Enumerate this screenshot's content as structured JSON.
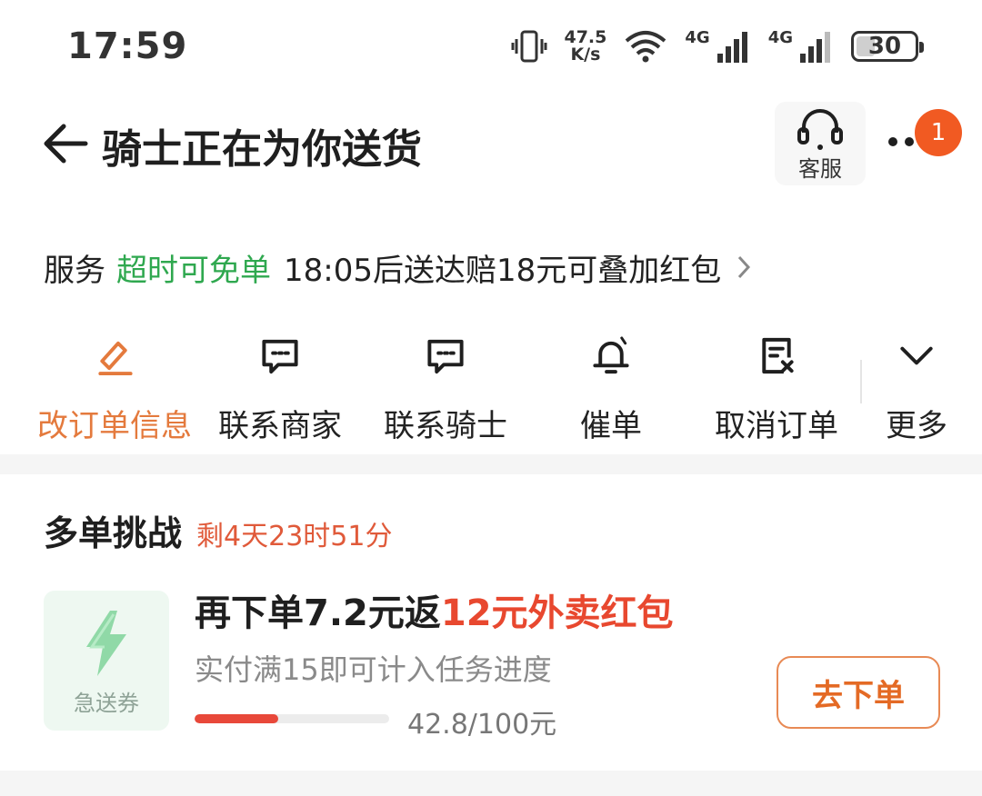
{
  "status_bar": {
    "time": "17:59",
    "speed_value": "47.5",
    "speed_unit": "K/s",
    "net1": "4G",
    "net2": "4G",
    "battery": "30"
  },
  "header": {
    "title": "骑士正在为你送货",
    "support_label": "客服",
    "badge_count": "1"
  },
  "service": {
    "label": "服务",
    "tag": "超时可免单",
    "description": "18:05后送达赔18元可叠加红包"
  },
  "actions": [
    {
      "label": "改订单信息",
      "icon": "edit-icon",
      "active": true
    },
    {
      "label": "联系商家",
      "icon": "chat-icon"
    },
    {
      "label": "联系骑士",
      "icon": "chat-icon"
    },
    {
      "label": "催单",
      "icon": "bell-icon"
    },
    {
      "label": "取消订单",
      "icon": "cancel-doc-icon"
    },
    {
      "label": "更多",
      "icon": "chevron-down-icon"
    }
  ],
  "challenge": {
    "title": "多单挑战",
    "timer": "剩4天23时51分",
    "coupon_label": "急送券",
    "offer_prefix": "再下单7.2元返",
    "offer_highlight": "12元外卖红包",
    "offer_sub": "实付满15即可计入任务进度",
    "progress_text": "42.8/100元",
    "progress_fraction": 0.428,
    "button_label": "去下单"
  },
  "colors": {
    "accent_orange": "#e47a3d",
    "green": "#2fa84f",
    "red": "#e8482f"
  }
}
